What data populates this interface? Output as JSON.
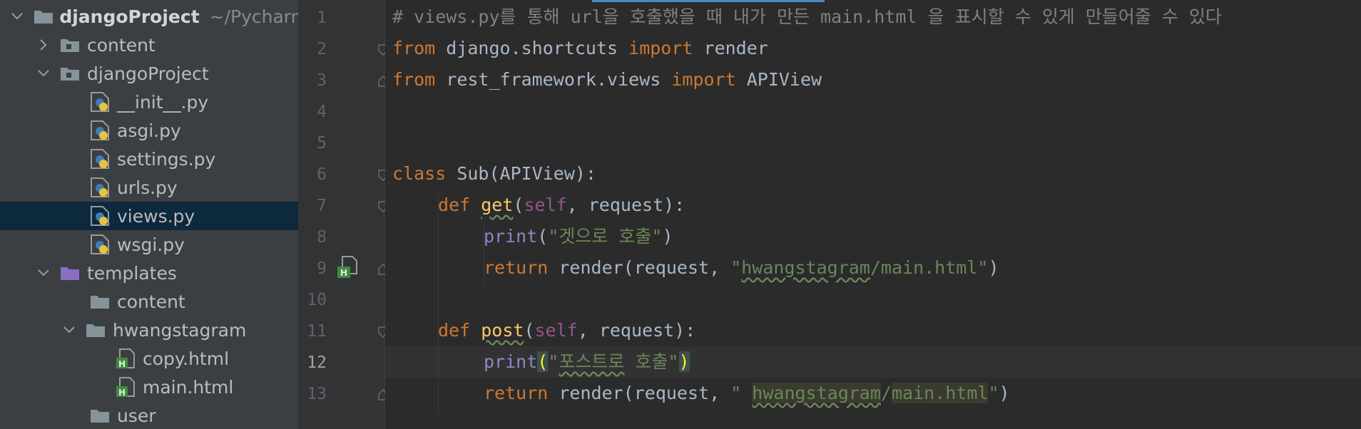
{
  "project_tree": {
    "root": {
      "name": "djangoProject",
      "path": "~/Pycharm"
    },
    "items": [
      {
        "label": "content",
        "type": "folder-module",
        "expanded": false
      },
      {
        "label": "djangoProject",
        "type": "folder-module",
        "expanded": true
      },
      {
        "label": "__init__.py",
        "type": "python-file"
      },
      {
        "label": "asgi.py",
        "type": "python-file"
      },
      {
        "label": "settings.py",
        "type": "python-file"
      },
      {
        "label": "urls.py",
        "type": "python-file"
      },
      {
        "label": "views.py",
        "type": "python-file",
        "selected": true
      },
      {
        "label": "wsgi.py",
        "type": "python-file"
      },
      {
        "label": "templates",
        "type": "folder-templates",
        "expanded": true
      },
      {
        "label": "content",
        "type": "folder"
      },
      {
        "label": "hwangstagram",
        "type": "folder",
        "expanded": true
      },
      {
        "label": "copy.html",
        "type": "html-file"
      },
      {
        "label": "main.html",
        "type": "html-file"
      },
      {
        "label": "user",
        "type": "folder"
      }
    ]
  },
  "editor": {
    "current_line": 12,
    "line_numbers": [
      "1",
      "2",
      "3",
      "4",
      "5",
      "6",
      "7",
      "8",
      "9",
      "10",
      "11",
      "12",
      "13"
    ],
    "code": {
      "l1": "# views.py를 통해 url을 호출했을 때 내가 만든 main.html 을 표시할 수 있게 만들어줄 수 있다",
      "l2_from": "from",
      "l2_mod": " django.shortcuts ",
      "l2_import": "import",
      "l2_name": " render",
      "l3_from": "from",
      "l3_mod": " rest_framework.views ",
      "l3_import": "import",
      "l3_name": " APIView",
      "l6_class": "class",
      "l6_name": " Sub",
      "l6_rest": "(APIView):",
      "l7_def": "def",
      "l7_fn": "get",
      "l7_open": "(",
      "l7_self": "self",
      "l7_rest": ", request):",
      "l8_print": "print",
      "l8_open": "(",
      "l8_str": "\"겟으로 호출\"",
      "l8_close": ")",
      "l9_return": "return",
      "l9_call": " render(request, ",
      "l9_q1": "\"",
      "l9_word": "hwangstagram",
      "l9_tail": "/main.html\"",
      "l9_close": ")",
      "l11_def": "def",
      "l11_fn": "post",
      "l11_open": "(",
      "l11_self": "self",
      "l11_rest": ", request):",
      "l12_print": "print",
      "l12_open": "(",
      "l12_q1": "\"",
      "l12_word": "포스트로",
      "l12_tail": " 호출\"",
      "l12_close": ")",
      "l13_return": "return",
      "l13_call": " render(request, ",
      "l13_q1": "\" ",
      "l13_word": "hwangstagram",
      "l13_slash": "/",
      "l13_file": "main.html",
      "l13_q2": "\"",
      "l13_close": ")"
    }
  },
  "colors": {
    "keyword": "#cc7832",
    "comment": "#808080",
    "string": "#6a8759",
    "function": "#ffc66d",
    "self": "#94558d",
    "builtin": "#8888c6",
    "selection": "#0d293e"
  },
  "icons": [
    "chevron-down-icon",
    "chevron-right-icon",
    "folder-icon",
    "module-folder-icon",
    "python-file-icon",
    "html-file-icon",
    "fold-marker-icon",
    "html-gutter-icon"
  ]
}
